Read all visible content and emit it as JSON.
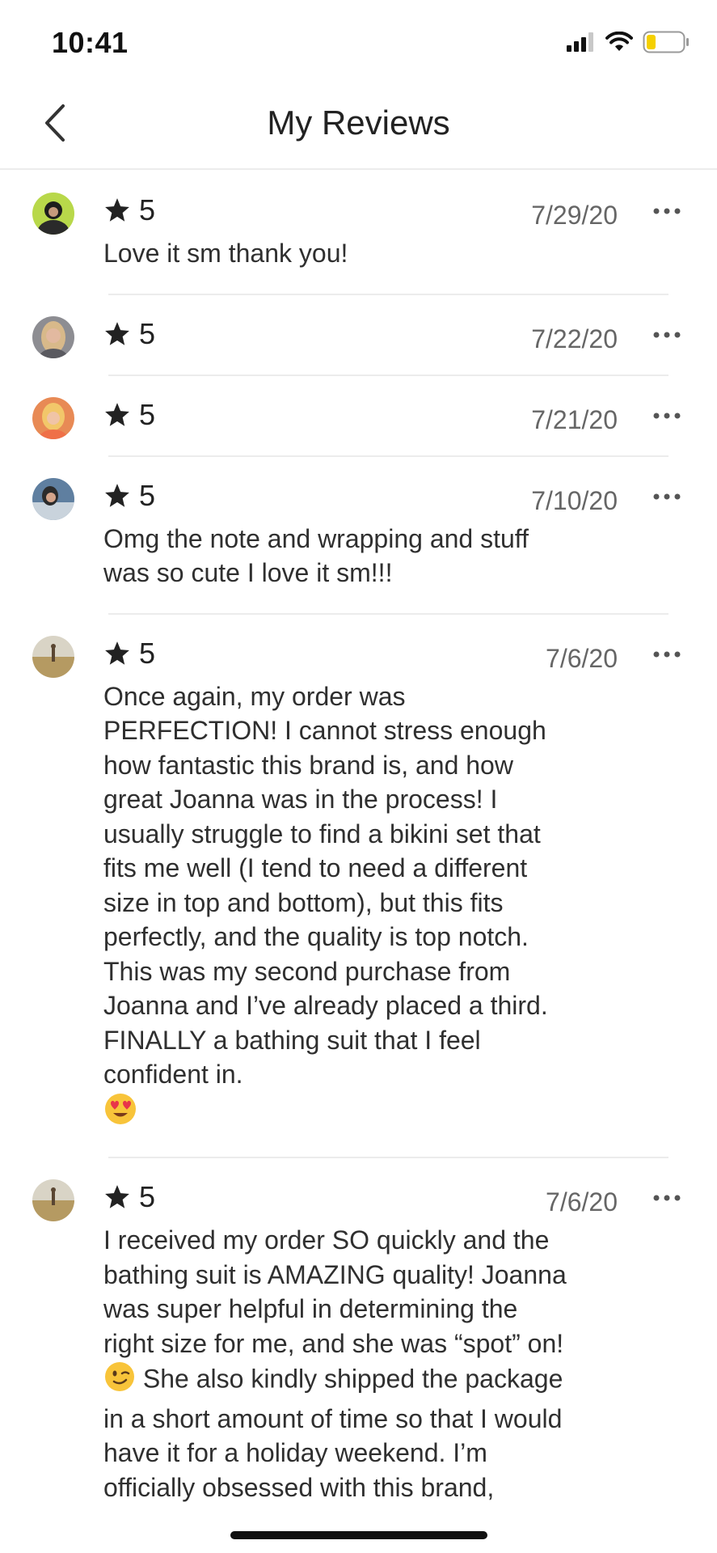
{
  "status_bar": {
    "time": "10:41"
  },
  "nav": {
    "title": "My Reviews"
  },
  "icons": {
    "back": "chevron-left-icon",
    "star": "star-icon",
    "more": "ellipsis-icon",
    "battery": "battery-icon",
    "wifi": "wifi-icon",
    "signal": "signal-icon"
  },
  "colors": {
    "star": "#222222",
    "battery_fill": "#f5d000",
    "divider": "#ececec",
    "date": "#666666"
  },
  "reviews": [
    {
      "rating": "5",
      "date": "7/29/20",
      "text": "Love it sm thank you!"
    },
    {
      "rating": "5",
      "date": "7/22/20",
      "text": ""
    },
    {
      "rating": "5",
      "date": "7/21/20",
      "text": ""
    },
    {
      "rating": "5",
      "date": "7/10/20",
      "text": "Omg the note and wrapping and stuff was so cute I love it sm!!!"
    },
    {
      "rating": "5",
      "date": "7/6/20",
      "text": "Once again, my order was PERFECTION! I cannot stress enough how fantastic this brand is, and how great Joanna was in the process! I usually struggle to find a bikini set that fits me well (I tend to need a different size in top and bottom), but this fits perfectly, and the quality is top notch. This was my second purchase from Joanna and I’ve already placed a third. FINALLY a bathing suit that I feel confident in.",
      "emoji": "heart-eyes-emoji"
    },
    {
      "rating": "5",
      "date": "7/6/20",
      "text_before": "I received my order SO quickly and the bathing suit is AMAZING quality! Joanna was super helpful in determining the right size for me, and she was “spot” on!",
      "emoji": "winking-face-emoji",
      "text_after": "She also kindly shipped the package in a short amount of time so that I would have it for a holiday weekend. I’m officially obsessed with this brand,"
    }
  ]
}
